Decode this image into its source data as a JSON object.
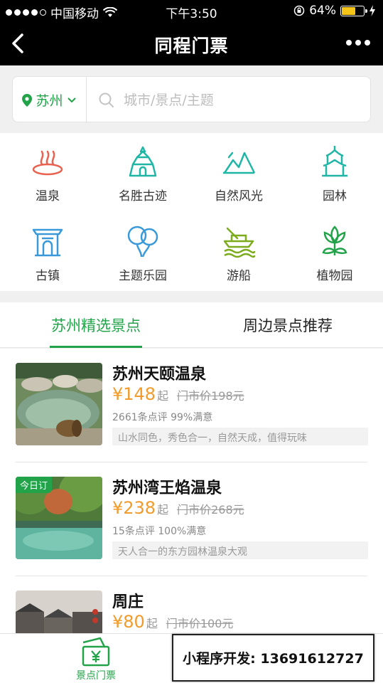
{
  "status_bar": {
    "carrier": "中国移动",
    "time": "下午3:50",
    "battery_percent": "64%",
    "battery_level": 0.64
  },
  "nav": {
    "title": "同程门票"
  },
  "search": {
    "city": "苏州",
    "placeholder": "城市/景点/主题"
  },
  "categories": [
    {
      "label": "温泉",
      "icon": "hot-spring-icon"
    },
    {
      "label": "名胜古迹",
      "icon": "historic-site-icon"
    },
    {
      "label": "自然风光",
      "icon": "mountain-icon"
    },
    {
      "label": "园林",
      "icon": "garden-pavilion-icon"
    },
    {
      "label": "古镇",
      "icon": "ancient-town-icon"
    },
    {
      "label": "主题乐园",
      "icon": "balloons-icon"
    },
    {
      "label": "游船",
      "icon": "boat-icon"
    },
    {
      "label": "植物园",
      "icon": "flower-icon"
    }
  ],
  "tabs": [
    {
      "label": "苏州精选景点",
      "active": true
    },
    {
      "label": "周边景点推荐",
      "active": false
    }
  ],
  "items": [
    {
      "name": "苏州天颐温泉",
      "price": "¥148",
      "price_suffix": "起",
      "original_price": "门市价198元",
      "stats": "2661条点评  99%满意",
      "desc": "山水同色，秀色合一，自然天成，值得玩味",
      "badge": ""
    },
    {
      "name": "苏州湾王焰温泉",
      "price": "¥238",
      "price_suffix": "起",
      "original_price": "门市价268元",
      "stats": "15条点评  100%满意",
      "desc": "天人合一的东方园林温泉大观",
      "badge": "今日订"
    },
    {
      "name": "周庄",
      "price": "¥80",
      "price_suffix": "起",
      "original_price": "门市价100元",
      "stats": "",
      "desc": "",
      "badge": ""
    }
  ],
  "bottom_bar": {
    "tab_label": "景点门票"
  },
  "promo": {
    "text": "小程序开发:  13691612727"
  },
  "colors": {
    "accent": "#22a34a",
    "price": "#f29b2b",
    "icon_red": "#e9614f",
    "icon_teal": "#1fb6a6",
    "icon_blue": "#3a9ad9"
  }
}
